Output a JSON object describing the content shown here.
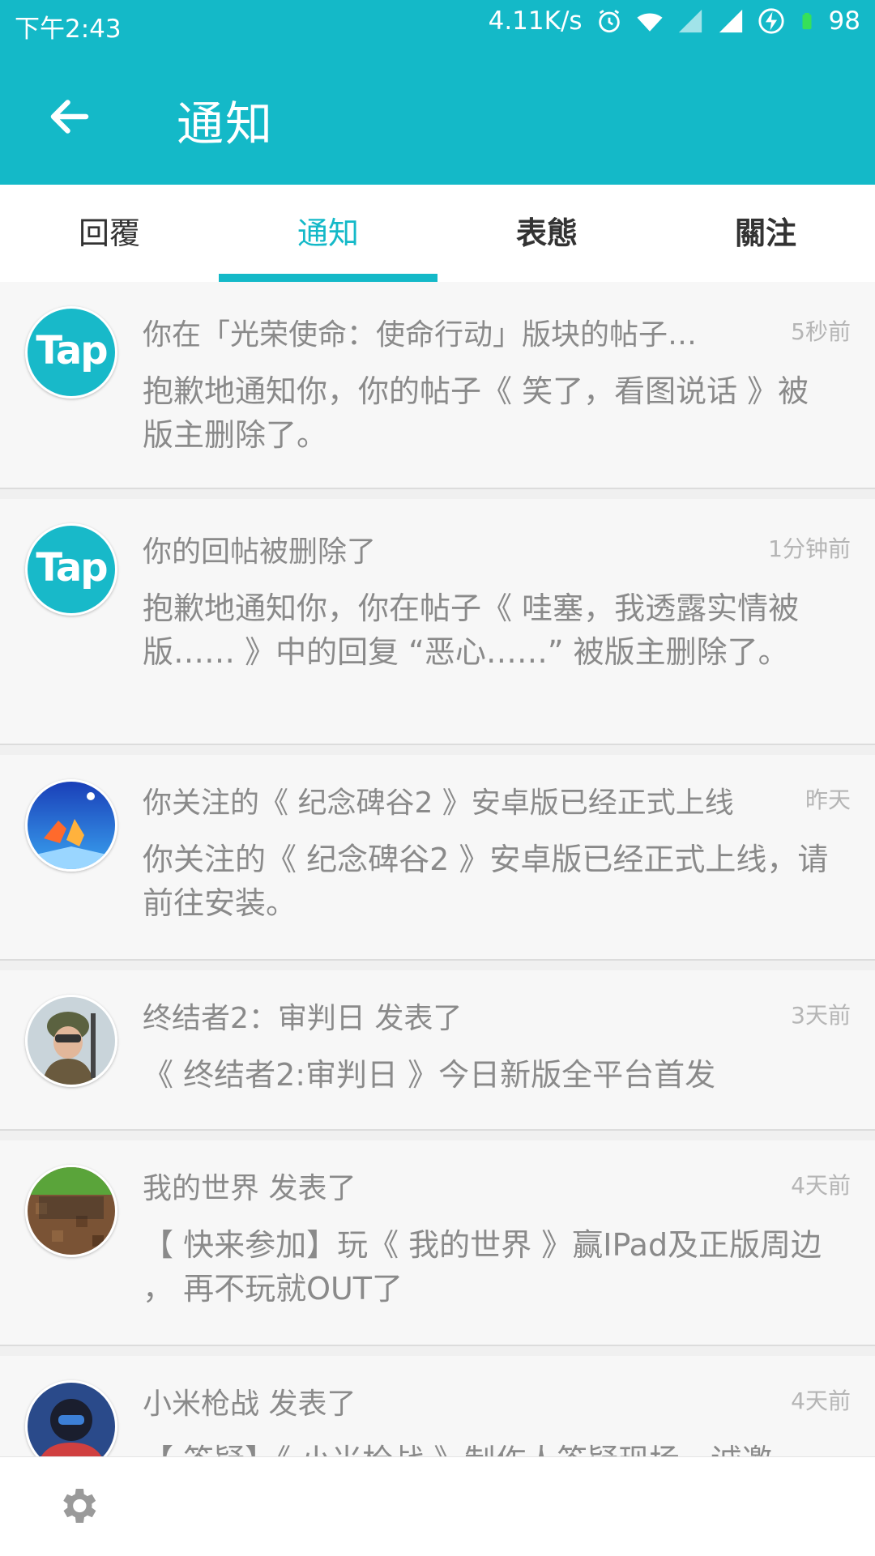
{
  "status_bar": {
    "time": "下午2:43",
    "speed": "4.11K/s",
    "battery": "98",
    "icons": [
      "alarm-icon",
      "wifi-icon",
      "signal-icon",
      "signal-icon",
      "charging-icon",
      "battery-icon"
    ]
  },
  "toolbar": {
    "title": "通知",
    "back_icon": "back-arrow-icon"
  },
  "tabs": [
    {
      "label": "回覆"
    },
    {
      "label": "通知"
    },
    {
      "label": "表態"
    },
    {
      "label": "關注"
    }
  ],
  "notifications": [
    {
      "avatar": "Tap",
      "title": "你在「光荣使命：使命行动」版块的帖子…",
      "time": "5秒前",
      "body": "抱歉地通知你，你的帖子《 笑了，看图说话 》被版主删除了。"
    },
    {
      "avatar": "Tap",
      "title": "你的回帖被删除了",
      "time": "1分钟前",
      "body": "抱歉地通知你，你在帖子《 哇塞，我透露实情被版…… 》中的回复 “恶心……” 被版主删除了。"
    },
    {
      "avatar_icon": "monument-valley-avatar",
      "title": "你关注的《 纪念碑谷2 》安卓版已经正式上线",
      "time": "昨天",
      "body": "你关注的《 纪念碑谷2 》安卓版已经正式上线，请前往安装。"
    },
    {
      "avatar_icon": "soldier-avatar",
      "title": "终结者2：审判日 发表了",
      "time": "3天前",
      "body": "《 终结者2:审判日 》今日新版全平台首发"
    },
    {
      "avatar_icon": "minecraft-avatar",
      "title": "我的世界 发表了",
      "time": "4天前",
      "body": "【 快来参加】玩《 我的世界 》赢IPad及正版周边 ， 再不玩就OUT了"
    },
    {
      "avatar_icon": "mi-gunfight-avatar",
      "title": "小米枪战 发表了",
      "time": "4天前",
      "body": "【 答疑】《 小米枪战 》制作人答疑现场，诚邀"
    }
  ],
  "bottom_bar": {
    "settings_icon": "gear-icon"
  },
  "colors": {
    "accent": "#14b9c8",
    "text_gray": "#8a8a8a",
    "time_gray": "#b5b5b5"
  }
}
